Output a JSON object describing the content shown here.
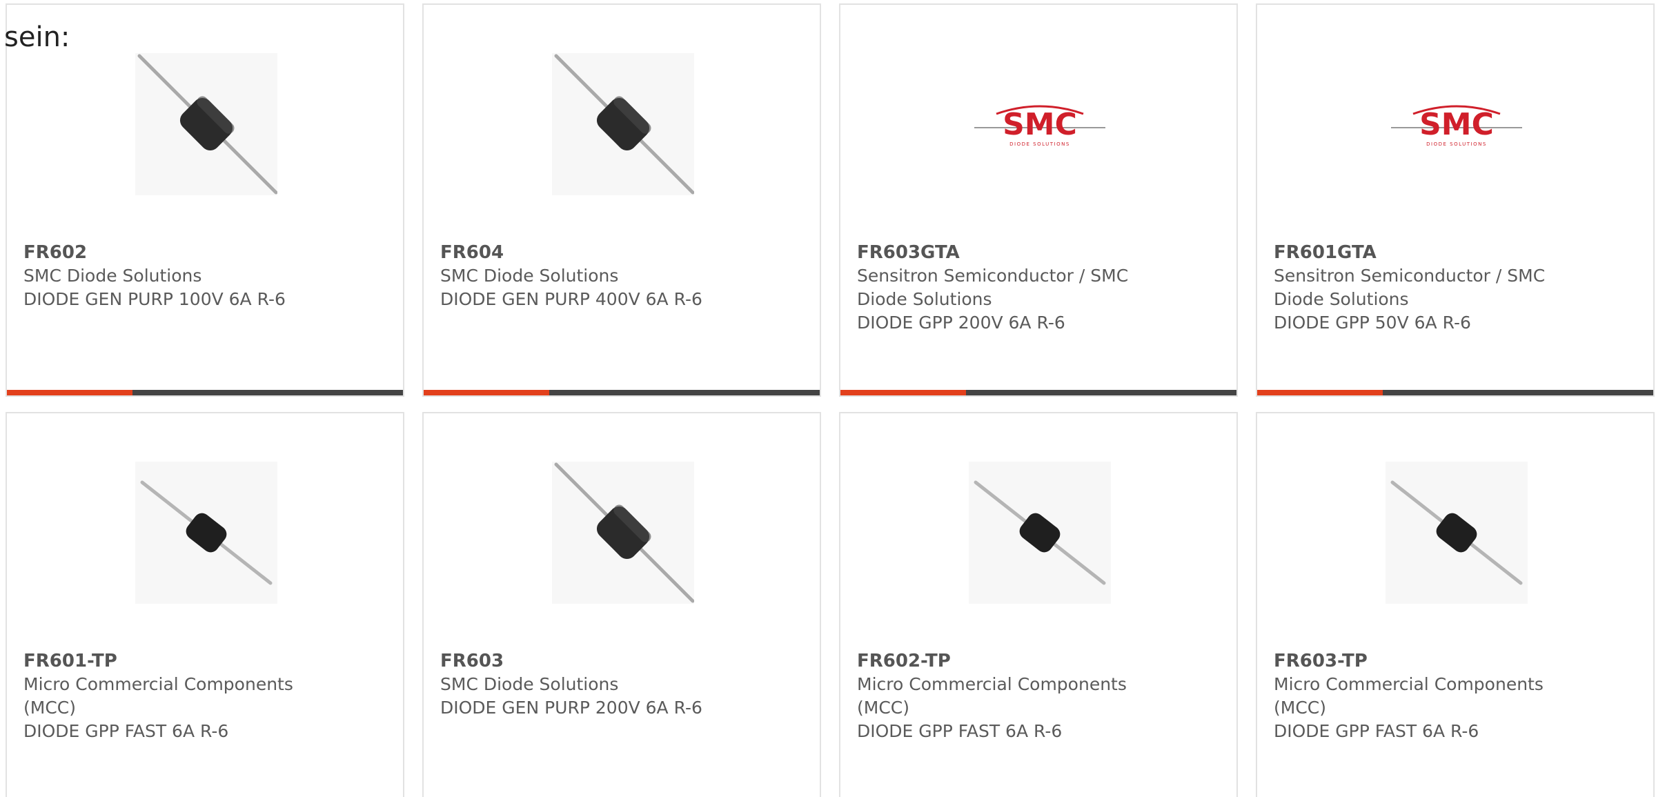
{
  "intro": {
    "text": "sein:"
  },
  "colors": {
    "accent": "#e2401c",
    "bar": "#444444",
    "border": "#e2e2e2"
  },
  "products": [
    {
      "part": "FR602",
      "manufacturer": "SMC Diode Solutions",
      "description": "DIODE GEN PURP 100V 6A R-6",
      "image": "diode-large"
    },
    {
      "part": "FR604",
      "manufacturer": "SMC Diode Solutions",
      "description": "DIODE GEN PURP 400V 6A R-6",
      "image": "diode-large"
    },
    {
      "part": "FR603GTA",
      "manufacturer": "Sensitron Semiconductor / SMC Diode Solutions",
      "description": "DIODE GPP 200V 6A R-6",
      "image": "smc-logo",
      "logo_text": "SMC",
      "logo_subtext": "DIODE SOLUTIONS"
    },
    {
      "part": "FR601GTA",
      "manufacturer": "Sensitron Semiconductor / SMC Diode Solutions",
      "description": "DIODE GPP 50V 6A R-6",
      "image": "smc-logo",
      "logo_text": "SMC",
      "logo_subtext": "DIODE SOLUTIONS"
    },
    {
      "part": "FR601-TP",
      "manufacturer": "Micro Commercial Components (MCC)",
      "description": "DIODE GPP FAST 6A R-6",
      "image": "diode-small"
    },
    {
      "part": "FR603",
      "manufacturer": "SMC Diode Solutions",
      "description": "DIODE GEN PURP 200V 6A R-6",
      "image": "diode-large"
    },
    {
      "part": "FR602-TP",
      "manufacturer": "Micro Commercial Components (MCC)",
      "description": "DIODE GPP FAST 6A R-6",
      "image": "diode-small"
    },
    {
      "part": "FR603-TP",
      "manufacturer": "Micro Commercial Components (MCC)",
      "description": "DIODE GPP FAST 6A R-6",
      "image": "diode-small"
    }
  ]
}
